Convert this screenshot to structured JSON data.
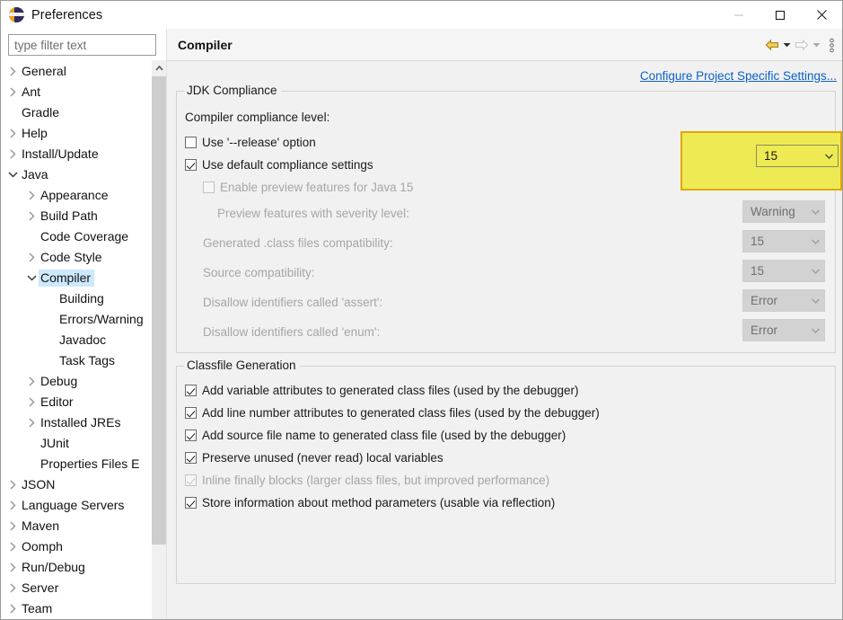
{
  "window": {
    "title": "Preferences",
    "icon": "eclipse-logo-icon",
    "controls": {
      "minimize": "minimize-icon",
      "maximize": "maximize-icon",
      "close": "close-icon"
    }
  },
  "sidebar": {
    "filter": {
      "value": "",
      "placeholder": "type filter text"
    },
    "items": [
      {
        "label": "General",
        "indent": 0,
        "twisty": "collapsed",
        "selected": false
      },
      {
        "label": "Ant",
        "indent": 0,
        "twisty": "collapsed",
        "selected": false
      },
      {
        "label": "Gradle",
        "indent": 0,
        "twisty": "none",
        "selected": false
      },
      {
        "label": "Help",
        "indent": 0,
        "twisty": "collapsed",
        "selected": false
      },
      {
        "label": "Install/Update",
        "indent": 0,
        "twisty": "collapsed",
        "selected": false
      },
      {
        "label": "Java",
        "indent": 0,
        "twisty": "expanded",
        "selected": false
      },
      {
        "label": "Appearance",
        "indent": 1,
        "twisty": "collapsed",
        "selected": false
      },
      {
        "label": "Build Path",
        "indent": 1,
        "twisty": "collapsed",
        "selected": false
      },
      {
        "label": "Code Coverage",
        "indent": 1,
        "twisty": "none",
        "selected": false
      },
      {
        "label": "Code Style",
        "indent": 1,
        "twisty": "collapsed",
        "selected": false
      },
      {
        "label": "Compiler",
        "indent": 1,
        "twisty": "expanded",
        "selected": true
      },
      {
        "label": "Building",
        "indent": 2,
        "twisty": "none",
        "selected": false
      },
      {
        "label": "Errors/Warning",
        "indent": 2,
        "twisty": "none",
        "selected": false
      },
      {
        "label": "Javadoc",
        "indent": 2,
        "twisty": "none",
        "selected": false
      },
      {
        "label": "Task Tags",
        "indent": 2,
        "twisty": "none",
        "selected": false
      },
      {
        "label": "Debug",
        "indent": 1,
        "twisty": "collapsed",
        "selected": false
      },
      {
        "label": "Editor",
        "indent": 1,
        "twisty": "collapsed",
        "selected": false
      },
      {
        "label": "Installed JREs",
        "indent": 1,
        "twisty": "collapsed",
        "selected": false
      },
      {
        "label": "JUnit",
        "indent": 1,
        "twisty": "none",
        "selected": false
      },
      {
        "label": "Properties Files E",
        "indent": 1,
        "twisty": "none",
        "selected": false
      },
      {
        "label": "JSON",
        "indent": 0,
        "twisty": "collapsed",
        "selected": false
      },
      {
        "label": "Language Servers",
        "indent": 0,
        "twisty": "collapsed",
        "selected": false
      },
      {
        "label": "Maven",
        "indent": 0,
        "twisty": "collapsed",
        "selected": false
      },
      {
        "label": "Oomph",
        "indent": 0,
        "twisty": "collapsed",
        "selected": false
      },
      {
        "label": "Run/Debug",
        "indent": 0,
        "twisty": "collapsed",
        "selected": false
      },
      {
        "label": "Server",
        "indent": 0,
        "twisty": "collapsed",
        "selected": false
      },
      {
        "label": "Team",
        "indent": 0,
        "twisty": "collapsed",
        "selected": false
      }
    ]
  },
  "header": {
    "title": "Compiler",
    "back_icon": "back-arrow-icon",
    "back_caret_icon": "chevron-down-icon",
    "forward_icon": "forward-arrow-icon",
    "forward_caret_icon": "chevron-down-icon",
    "menu_icon": "view-menu-icon"
  },
  "main": {
    "configure_link": "Configure Project Specific Settings...",
    "jdk_group": {
      "title": "JDK Compliance",
      "compliance_label": "Compiler compliance level:",
      "compliance_value": "15",
      "use_release": {
        "label": "Use '--release' option",
        "checked": false,
        "disabled": false
      },
      "use_default": {
        "label": "Use default compliance settings",
        "checked": true,
        "disabled": false
      },
      "enable_preview": {
        "label": "Enable preview features for Java 15",
        "checked": false,
        "disabled": true
      },
      "preview_severity_label": "Preview features with severity level:",
      "preview_severity_value": "Warning",
      "class_compat_label": "Generated .class files compatibility:",
      "class_compat_value": "15",
      "source_compat_label": "Source compatibility:",
      "source_compat_value": "15",
      "assert_label": "Disallow identifiers called 'assert':",
      "assert_value": "Error",
      "enum_label": "Disallow identifiers called 'enum':",
      "enum_value": "Error"
    },
    "classfile_group": {
      "title": "Classfile Generation",
      "options": [
        {
          "label": "Add variable attributes to generated class files (used by the debugger)",
          "checked": true,
          "disabled": false
        },
        {
          "label": "Add line number attributes to generated class files (used by the debugger)",
          "checked": true,
          "disabled": false
        },
        {
          "label": "Add source file name to generated class file (used by the debugger)",
          "checked": true,
          "disabled": false
        },
        {
          "label": "Preserve unused (never read) local variables",
          "checked": true,
          "disabled": false
        },
        {
          "label": "Inline finally blocks (larger class files, but improved performance)",
          "checked": true,
          "disabled": true
        },
        {
          "label": "Store information about method parameters (usable via reflection)",
          "checked": true,
          "disabled": false
        }
      ]
    }
  },
  "highlight": {
    "name": "compliance-level-highlight",
    "color": "#eeea53",
    "border_color": "#e0a800"
  },
  "colors": {
    "accent_link": "#0b61c5",
    "selection": "#cde8ff",
    "panel_bg": "#f1f1f1",
    "disabled_text": "#a6a6a6"
  }
}
